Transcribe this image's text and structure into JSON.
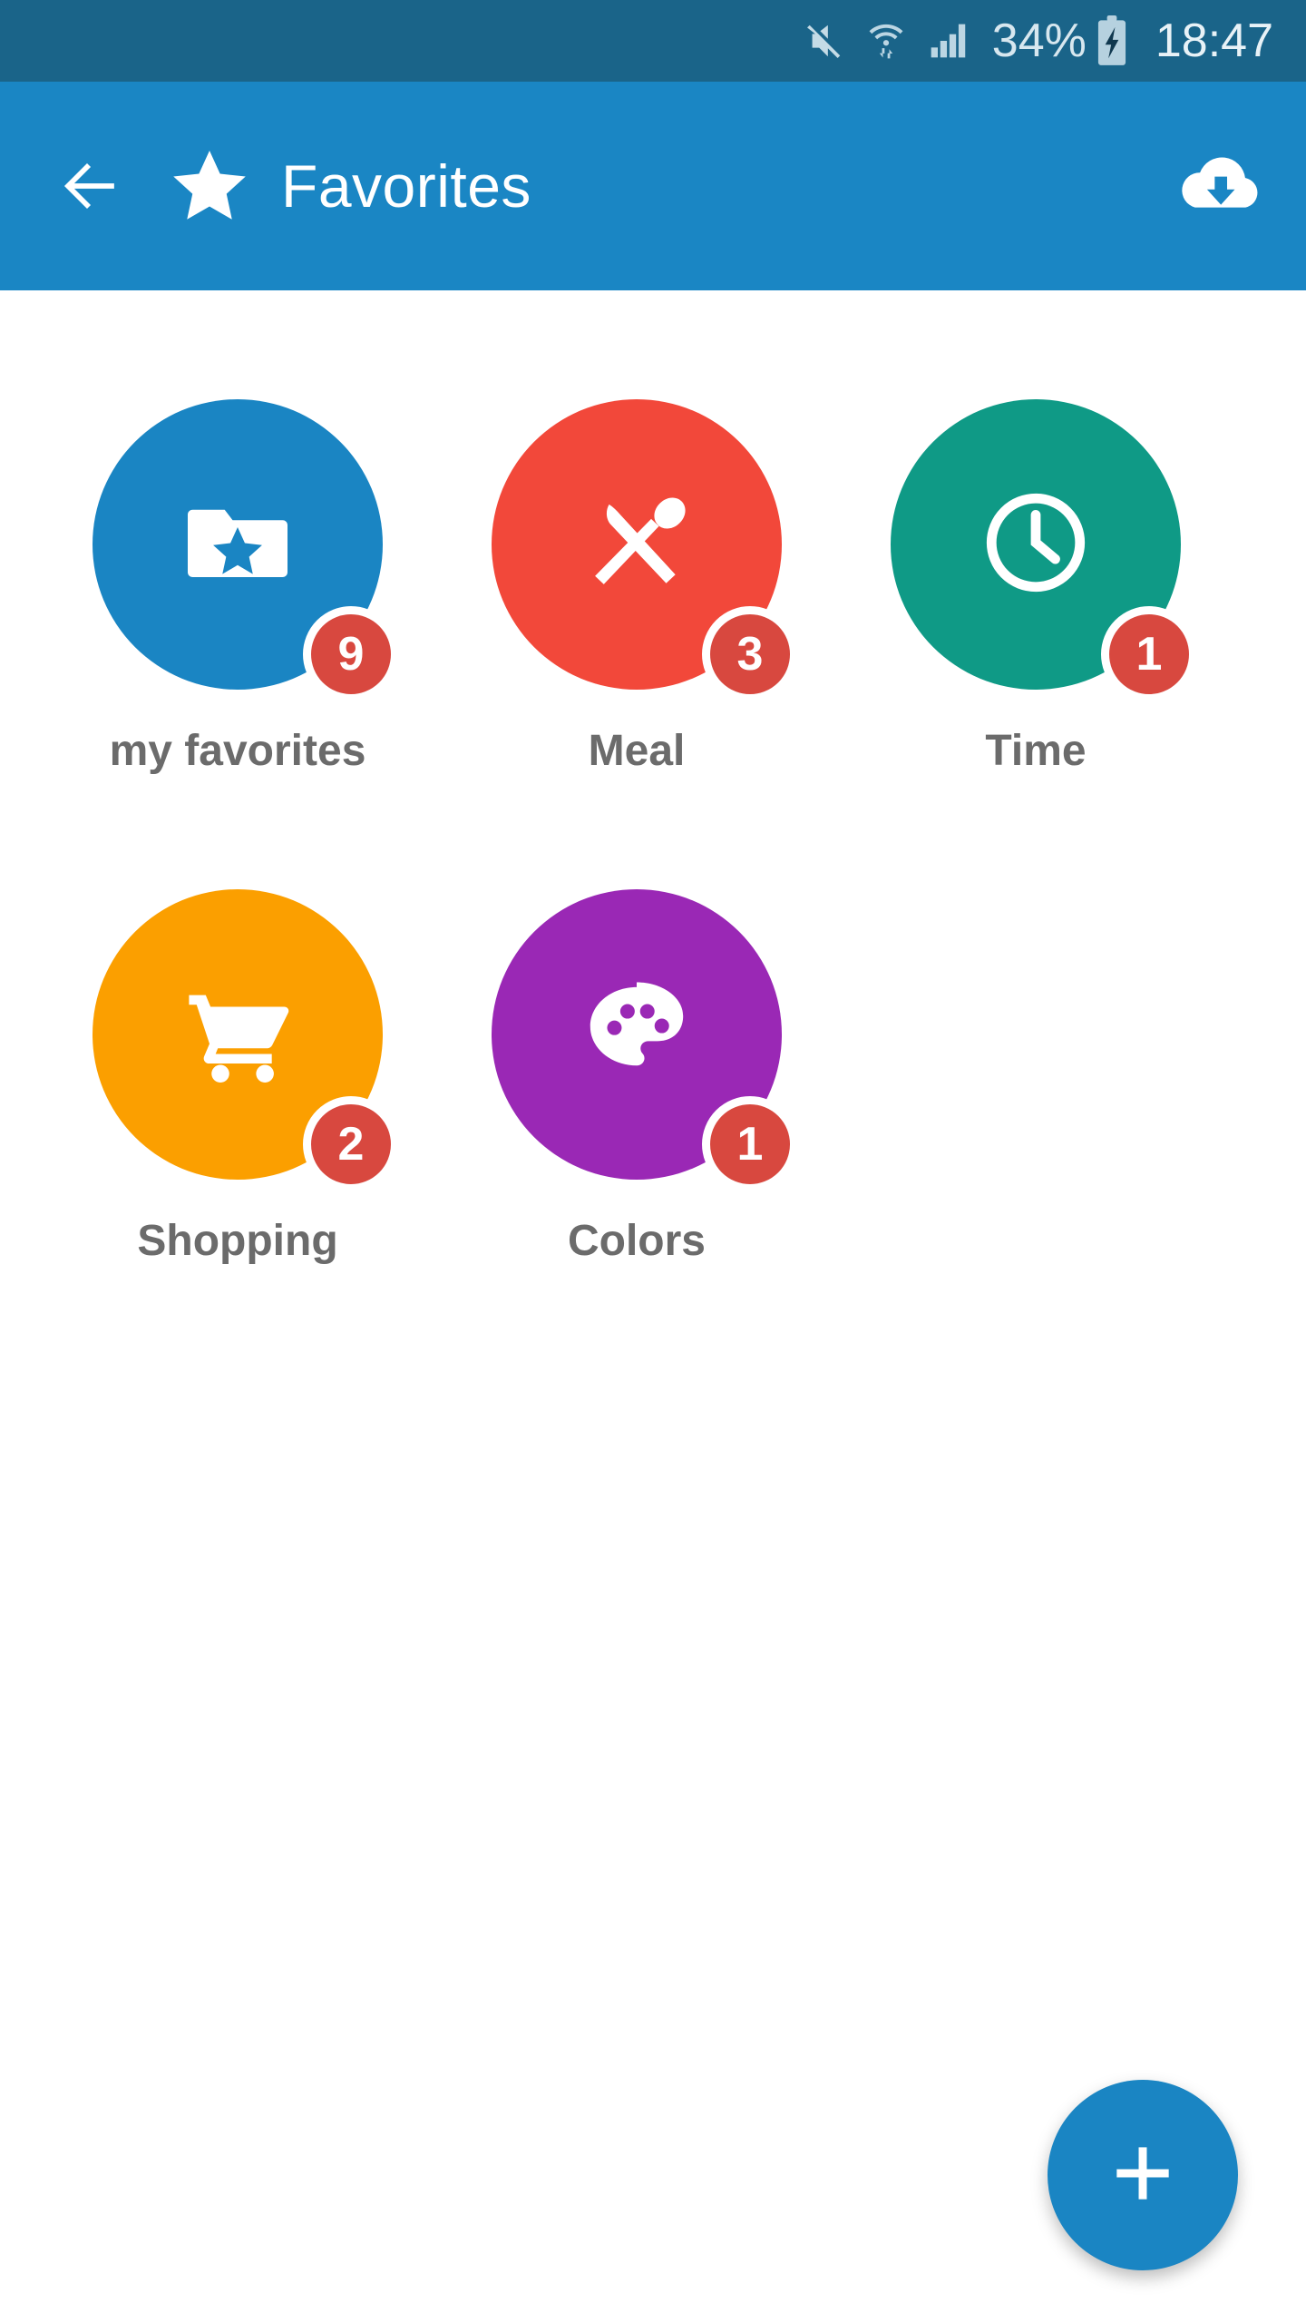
{
  "status_bar": {
    "background": "#1a6489",
    "icons": [
      "mute-icon",
      "wifi-icon",
      "signal-icon",
      "battery-charging-icon"
    ],
    "battery_percent": "34%",
    "time": "18:47"
  },
  "app_bar": {
    "background": "#1a86c4",
    "back_icon": "back-arrow-icon",
    "leading_icon": "star-icon",
    "title": "Favorites",
    "action_icon": "cloud-download-icon"
  },
  "categories": [
    {
      "label": "my favorites",
      "badge": "9",
      "color": "#1a85c3",
      "icon": "folder-star-icon"
    },
    {
      "label": "Meal",
      "badge": "3",
      "color": "#f2483a",
      "icon": "cutlery-icon"
    },
    {
      "label": "Time",
      "badge": "1",
      "color": "#0f9a86",
      "icon": "clock-icon"
    },
    {
      "label": "Shopping",
      "badge": "2",
      "color": "#fb9f00",
      "icon": "shopping-cart-icon"
    },
    {
      "label": "Colors",
      "badge": "1",
      "color": "#9a28b5",
      "icon": "palette-icon"
    }
  ],
  "badge_color": "#d8483f",
  "label_color": "#6b6b6b",
  "fab": {
    "icon": "plus-icon",
    "color": "#1a85c3",
    "label": "+"
  }
}
